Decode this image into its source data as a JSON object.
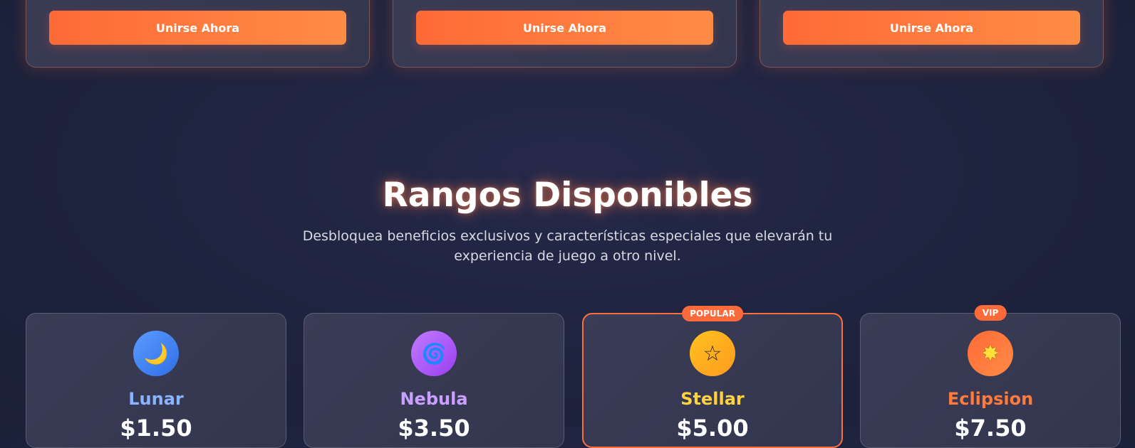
{
  "join_cards": [
    {
      "button_label": "Unirse Ahora"
    },
    {
      "button_label": "Unirse Ahora"
    },
    {
      "button_label": "Unirse Ahora"
    }
  ],
  "ranks_section": {
    "title": "Rangos Disponibles",
    "subtitle": "Desbloquea beneficios exclusivos y características especiales que elevarán tu experiencia de juego a otro nivel.",
    "ranks": [
      {
        "name": "Lunar",
        "price": "$1.50",
        "icon": "crescent-moon-icon",
        "glyph": "🌙",
        "badge": "",
        "name_color": "#8ab4ff",
        "icon_bg": "#3b82f6"
      },
      {
        "name": "Nebula",
        "price": "$3.50",
        "icon": "nebula-icon",
        "glyph": "🌀",
        "badge": "",
        "name_color": "#c9a0ff",
        "icon_bg": "#a855f7"
      },
      {
        "name": "Stellar",
        "price": "$5.00",
        "icon": "star-icon",
        "glyph": "☆",
        "badge": "POPULAR",
        "name_color": "#ffd23f",
        "icon_bg": "#ffb01f"
      },
      {
        "name": "Eclipsion",
        "price": "$7.50",
        "icon": "sparkle-burst-icon",
        "glyph": "✸",
        "badge": "VIP",
        "name_color": "#ff7a3d",
        "icon_bg": "#ff7a3a"
      }
    ]
  },
  "colors": {
    "accent": "#ff6a36",
    "background": "#1f2440"
  }
}
